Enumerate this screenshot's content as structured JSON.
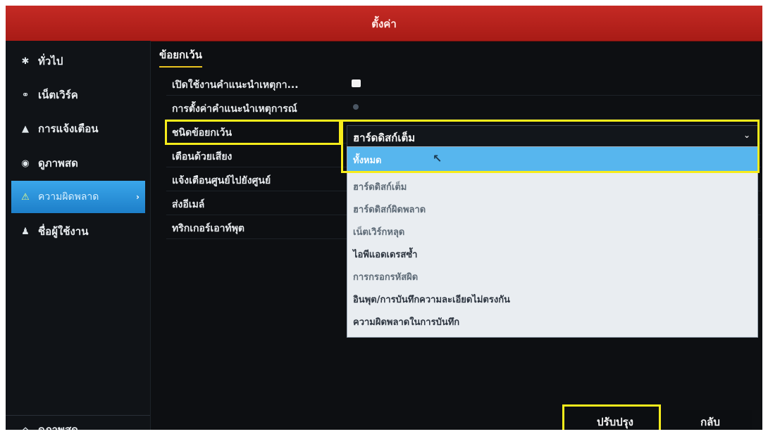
{
  "window": {
    "title": "ตั้งค่า"
  },
  "sidebar": {
    "items": [
      {
        "label": "ทั่วไป",
        "icon": "gear-icon"
      },
      {
        "label": "เน็ตเวิร์ค",
        "icon": "network-icon"
      },
      {
        "label": "การแจ้งเตือน",
        "icon": "alarm-icon"
      },
      {
        "label": "ดูภาพสด",
        "icon": "eye-icon"
      },
      {
        "label": "ความผิดพลาด",
        "icon": "warning-icon",
        "active": true
      },
      {
        "label": "ชื่อผู้ใช้งาน",
        "icon": "users-icon"
      }
    ],
    "bottom": {
      "label": "ดูภาพสด",
      "icon": "home-icon"
    }
  },
  "main": {
    "tab_label": "ข้อยกเว้น",
    "rows": [
      {
        "label": "เปิดใช้งานคำแนะนำเหตุกา...",
        "control": "checkbox",
        "checked": true
      },
      {
        "label": "การตั้งค่าคำแนะนำเหตุการณ์",
        "control": "radio"
      },
      {
        "label": "ชนิดข้อยกเว้น",
        "control": "select"
      },
      {
        "label": "เตือนด้วยเสียง"
      },
      {
        "label": "แจ้งเตือนศูนย์ไปยังศูนย์"
      },
      {
        "label": "ส่งอีเมล์"
      },
      {
        "label": "ทริกเกอร์เอาท์พุต"
      }
    ],
    "exception_type": {
      "value": "ฮาร์ดดิสก์เต็ม",
      "options": [
        "ทั้งหมด",
        "ฮาร์ดดิสก์เต็ม",
        "ฮาร์ดดิสก์ผิดพลาด",
        "เน็ตเวิร์กหลุด",
        "ไอพีแอดเดรสซ้ำ",
        "การกรอกรหัสผิด",
        "อินพุต/การบันทึกความละเอียดไม่ตรงกัน",
        "ความผิดพลาดในการบันทึก"
      ],
      "highlighted_option": "ทั้งหมด"
    }
  },
  "footer": {
    "apply_label": "ปรับปรุง",
    "back_label": "กลับ"
  },
  "colors": {
    "title_bar": "#b8221c",
    "active_nav": "#2b95dd",
    "highlight_box": "#f7ec1b",
    "tab_underline": "#e9c420"
  }
}
